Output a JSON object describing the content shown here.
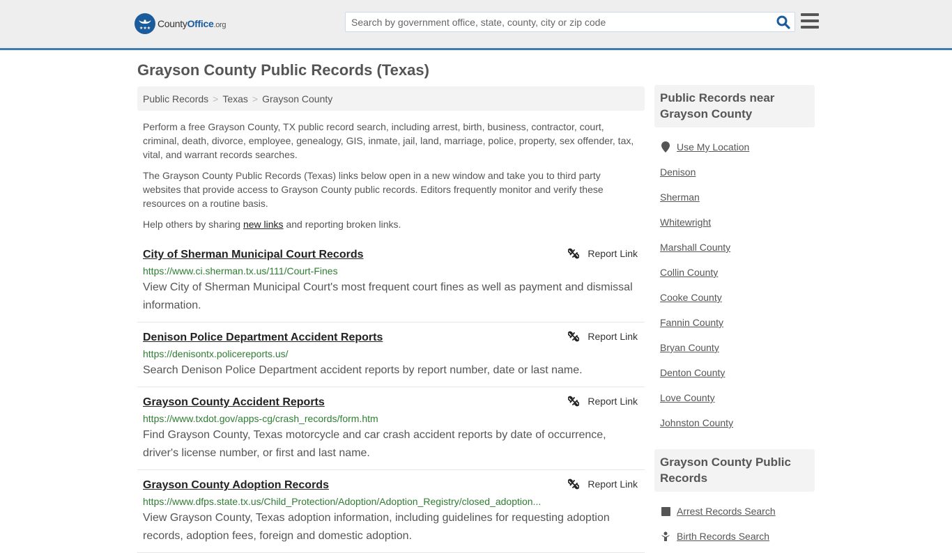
{
  "header": {
    "logo": {
      "county": "County",
      "office": "Office",
      "org": ".org"
    },
    "search_placeholder": "Search by government office, state, county, city or zip code",
    "search_value": "",
    "icons": {
      "search": "search-icon",
      "menu": "hamburger-menu-icon"
    },
    "colors": {
      "brand": "#1b5b9c",
      "accent_border": "#3b7bb0"
    }
  },
  "page_title": "Grayson County Public Records (Texas)",
  "breadcrumb": [
    {
      "label": "Public Records"
    },
    {
      "label": "Texas"
    },
    {
      "label": "Grayson County"
    }
  ],
  "breadcrumb_separator": ">",
  "intro": {
    "p1": "Perform a free Grayson County, TX public record search, including arrest, birth, business, contractor, court, criminal, death, divorce, employee, genealogy, GIS, inmate, jail, land, marriage, police, property, sex offender, tax, vital, and warrant records searches.",
    "p2": "The Grayson County Public Records (Texas) links below open in a new window and take you to third party websites that provide access to Grayson County public records. Editors frequently monitor and verify these resources on a routine basis.",
    "p3_before": "Help others by sharing ",
    "p3_link": "new links",
    "p3_after": " and reporting broken links."
  },
  "report_link_label": "Report Link",
  "records": [
    {
      "title": "City of Sherman Municipal Court Records",
      "url": "https://www.ci.sherman.tx.us/111/Court-Fines",
      "description": "View City of Sherman Municipal Court's most frequent court fines as well as payment and dismissal information."
    },
    {
      "title": "Denison Police Department Accident Reports",
      "url": "https://denisontx.policereports.us/",
      "description": "Search Denison Police Department accident reports by report number, date or last name."
    },
    {
      "title": "Grayson County Accident Reports",
      "url": "https://www.txdot.gov/apps-cg/crash_records/form.htm",
      "description": "Find Grayson County, Texas motorcycle and car crash accident reports by date of occurrence, driver's license number, or first and last name."
    },
    {
      "title": "Grayson County Adoption Records",
      "url": "https://www.dfps.state.tx.us/Child_Protection/Adoption/Adoption_Registry/closed_adoption...",
      "description": "View Grayson County, Texas adoption information, including guidelines for requesting adoption records, adoption fees, foreign and domestic adoption."
    }
  ],
  "sidebar": {
    "nearby_heading": "Public Records near Grayson County",
    "use_location": "Use My Location",
    "nearby": [
      "Denison",
      "Sherman",
      "Whitewright",
      "Marshall County",
      "Collin County",
      "Cooke County",
      "Fannin County",
      "Bryan County",
      "Denton County",
      "Love County",
      "Johnston County"
    ],
    "county_heading": "Grayson County Public Records",
    "county_links": [
      {
        "label": "Arrest Records Search",
        "icon": "square-icon"
      },
      {
        "label": "Birth Records Search",
        "icon": "baby-icon"
      }
    ]
  }
}
